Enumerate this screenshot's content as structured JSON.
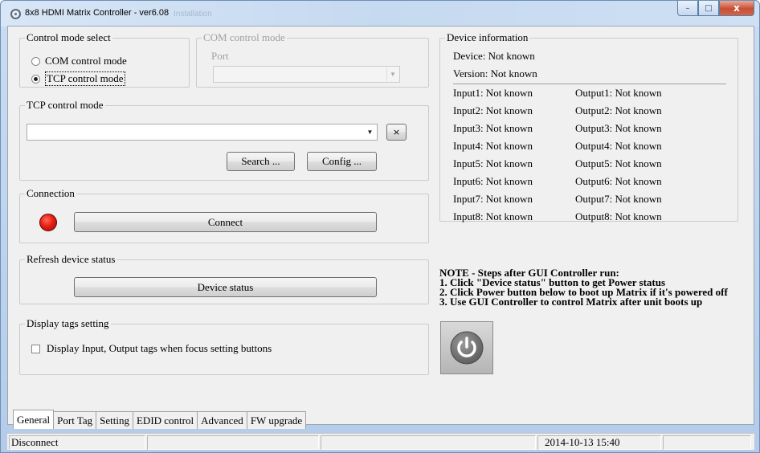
{
  "window": {
    "title": "8x8 HDMI Matrix Controller - ver6.08",
    "background_title": "Installation",
    "minimize": "–",
    "maximize": "□",
    "close": "x"
  },
  "control_mode": {
    "title": "Control mode select",
    "options": [
      "COM control mode",
      "TCP control mode"
    ],
    "selected": "TCP control mode"
  },
  "com_mode": {
    "title": "COM control mode",
    "port_label": "Port",
    "port_value": ""
  },
  "tcp_mode": {
    "title": "TCP control mode",
    "address_value": "",
    "clear_label": "×",
    "search_label": "Search ...",
    "config_label": "Config ..."
  },
  "connection": {
    "title": "Connection",
    "connect_label": "Connect",
    "status_color": "#e81e12"
  },
  "refresh": {
    "title": "Refresh device status",
    "button_label": "Device status"
  },
  "display_tags": {
    "title": "Display tags setting",
    "checkbox_label": "Display Input, Output tags when focus setting buttons",
    "checked": false
  },
  "device_info": {
    "title": "Device information",
    "device": "Device: Not known",
    "version": "Version: Not known",
    "inputs": [
      "Input1: Not known",
      "Input2: Not known",
      "Input3: Not known",
      "Input4: Not known",
      "Input5: Not known",
      "Input6: Not known",
      "Input7: Not known",
      "Input8: Not known"
    ],
    "outputs": [
      "Output1: Not known",
      "Output2: Not known",
      "Output3: Not known",
      "Output4: Not known",
      "Output5: Not known",
      "Output6: Not known",
      "Output7: Not known",
      "Output8: Not known"
    ]
  },
  "note": {
    "lines": [
      "NOTE - Steps after GUI Controller run:",
      "1. Click \"Device status\" button to get Power status",
      "2. Click Power button below to boot up Matrix if it's powered off",
      "3. Use GUI Controller to control Matrix after unit boots up"
    ]
  },
  "power_button": {
    "icon": "power-icon"
  },
  "tabs": [
    "General",
    "Port Tag",
    "Setting",
    "EDID control",
    "Advanced",
    "FW upgrade"
  ],
  "active_tab": "General",
  "statusbar": {
    "status": "Disconnect",
    "datetime": "2014-10-13 15:40"
  }
}
